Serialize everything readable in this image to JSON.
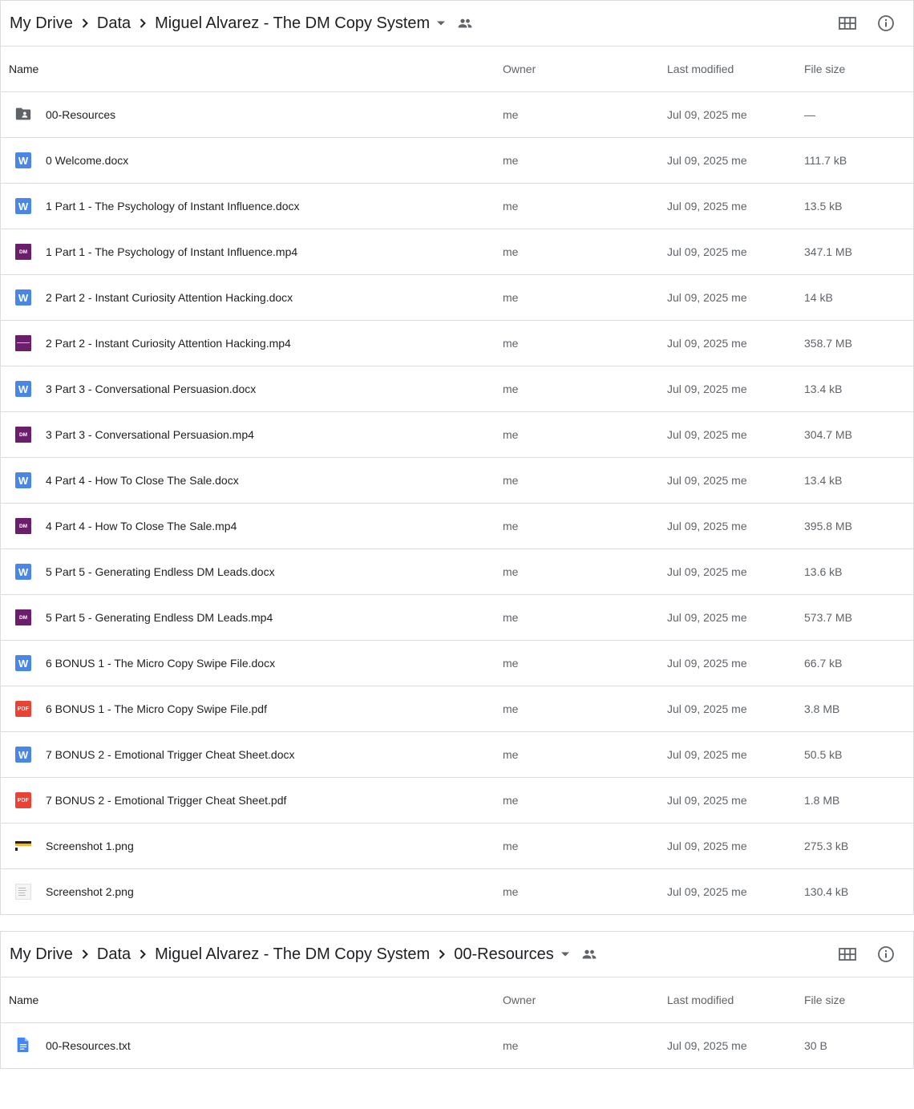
{
  "panel1": {
    "breadcrumbs": [
      "My Drive",
      "Data",
      "Miguel Alvarez - The DM Copy System"
    ],
    "columns": {
      "name": "Name",
      "owner": "Owner",
      "modified": "Last modified",
      "size": "File size"
    },
    "rows": [
      {
        "icon": "shared-folder-icon",
        "name": "00-Resources",
        "owner": "me",
        "modified": "Jul 09, 2025 me",
        "size": "—"
      },
      {
        "icon": "word-doc-icon",
        "name": "0 Welcome.docx",
        "owner": "me",
        "modified": "Jul 09, 2025 me",
        "size": "111.7 kB"
      },
      {
        "icon": "word-doc-icon",
        "name": "1 Part 1 - The Psychology of Instant Influence.docx",
        "owner": "me",
        "modified": "Jul 09, 2025 me",
        "size": "13.5 kB"
      },
      {
        "icon": "video-thumbnail-icon",
        "name": "1 Part 1 - The Psychology of Instant Influence.mp4",
        "owner": "me",
        "modified": "Jul 09, 2025 me",
        "size": "347.1 MB"
      },
      {
        "icon": "word-doc-icon",
        "name": "2 Part 2 - Instant Curiosity Attention Hacking.docx",
        "owner": "me",
        "modified": "Jul 09, 2025 me",
        "size": "14 kB"
      },
      {
        "icon": "video-thumbnail-plain-icon",
        "name": "2 Part 2 - Instant Curiosity Attention Hacking.mp4",
        "owner": "me",
        "modified": "Jul 09, 2025 me",
        "size": "358.7 MB"
      },
      {
        "icon": "word-doc-icon",
        "name": "3 Part 3 - Conversational Persuasion.docx",
        "owner": "me",
        "modified": "Jul 09, 2025 me",
        "size": "13.4 kB"
      },
      {
        "icon": "video-thumbnail-icon",
        "name": "3 Part 3 - Conversational Persuasion.mp4",
        "owner": "me",
        "modified": "Jul 09, 2025 me",
        "size": "304.7 MB"
      },
      {
        "icon": "word-doc-icon",
        "name": "4 Part 4 - How To Close The Sale.docx",
        "owner": "me",
        "modified": "Jul 09, 2025 me",
        "size": "13.4 kB"
      },
      {
        "icon": "video-thumbnail-icon",
        "name": "4 Part 4 - How To Close The Sale.mp4",
        "owner": "me",
        "modified": "Jul 09, 2025 me",
        "size": "395.8 MB"
      },
      {
        "icon": "word-doc-icon",
        "name": "5 Part 5 - Generating Endless DM Leads.docx",
        "owner": "me",
        "modified": "Jul 09, 2025 me",
        "size": "13.6 kB"
      },
      {
        "icon": "video-thumbnail-icon",
        "name": "5 Part 5 - Generating Endless DM Leads.mp4",
        "owner": "me",
        "modified": "Jul 09, 2025 me",
        "size": "573.7 MB"
      },
      {
        "icon": "word-doc-icon",
        "name": "6 BONUS 1 - The Micro Copy Swipe File.docx",
        "owner": "me",
        "modified": "Jul 09, 2025 me",
        "size": "66.7 kB"
      },
      {
        "icon": "pdf-icon",
        "name": "6 BONUS 1 - The Micro Copy Swipe File.pdf",
        "owner": "me",
        "modified": "Jul 09, 2025 me",
        "size": "3.8 MB"
      },
      {
        "icon": "word-doc-icon",
        "name": "7 BONUS 2 - Emotional Trigger Cheat Sheet.docx",
        "owner": "me",
        "modified": "Jul 09, 2025 me",
        "size": "50.5 kB"
      },
      {
        "icon": "pdf-icon",
        "name": "7 BONUS 2 - Emotional Trigger Cheat Sheet.pdf",
        "owner": "me",
        "modified": "Jul 09, 2025 me",
        "size": "1.8 MB"
      },
      {
        "icon": "image-thumbnail-dark-icon",
        "name": "Screenshot 1.png",
        "owner": "me",
        "modified": "Jul 09, 2025 me",
        "size": "275.3 kB"
      },
      {
        "icon": "image-thumbnail-light-icon",
        "name": "Screenshot 2.png",
        "owner": "me",
        "modified": "Jul 09, 2025 me",
        "size": "130.4 kB"
      }
    ]
  },
  "panel2": {
    "breadcrumbs": [
      "My Drive",
      "Data",
      "Miguel Alvarez - The DM Copy System",
      "00-Resources"
    ],
    "columns": {
      "name": "Name",
      "owner": "Owner",
      "modified": "Last modified",
      "size": "File size"
    },
    "rows": [
      {
        "icon": "text-doc-icon",
        "name": "00-Resources.txt",
        "owner": "me",
        "modified": "Jul 09, 2025 me",
        "size": "30 B"
      }
    ]
  },
  "icons": {
    "pdf_label": "PDF",
    "video_label": "DM"
  },
  "colors": {
    "word": "#4a86e8",
    "pdf": "#ea4335",
    "video": "#6b1e6b",
    "docs": "#4285f4",
    "border": "#dadce0",
    "muted": "#5f6368"
  }
}
